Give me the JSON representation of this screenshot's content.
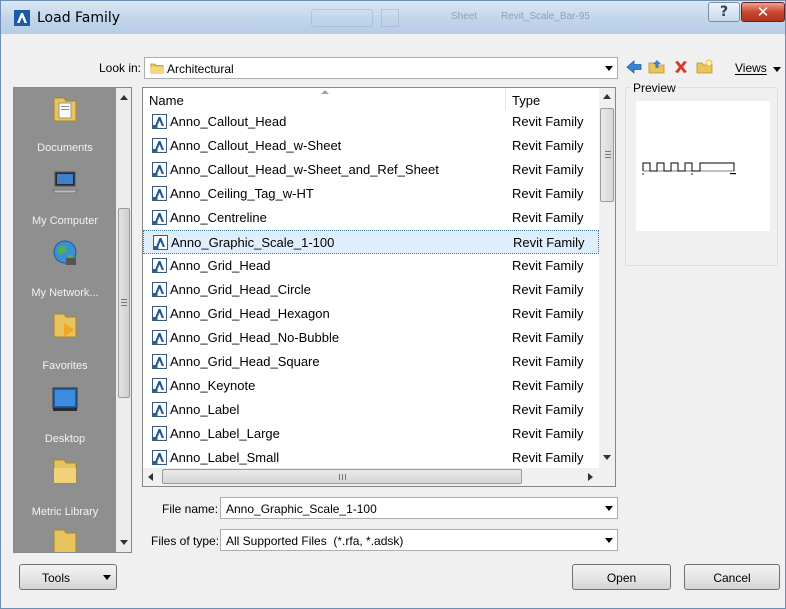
{
  "window": {
    "title": "Load Family",
    "background_titles": [
      "Sheet",
      "Revit_Scale_Bar-95"
    ]
  },
  "lookin": {
    "label": "Look in:",
    "value": "Architectural"
  },
  "toolbar": {
    "icons": [
      "back-icon",
      "up-folder-icon",
      "delete-icon",
      "new-folder-icon"
    ],
    "views_label": "Views"
  },
  "places": [
    {
      "label": "Documents",
      "icon": "documents-icon"
    },
    {
      "label": "My Computer",
      "icon": "computer-icon"
    },
    {
      "label": "My Network...",
      "icon": "network-icon"
    },
    {
      "label": "Favorites",
      "icon": "favorites-icon"
    },
    {
      "label": "Desktop",
      "icon": "desktop-icon"
    },
    {
      "label": "Metric Library",
      "icon": "folder-icon"
    }
  ],
  "filelist": {
    "columns": {
      "name": "Name",
      "type": "Type"
    },
    "rows": [
      {
        "name": "Anno_Callout_Head",
        "type": "Revit Family"
      },
      {
        "name": "Anno_Callout_Head_w-Sheet",
        "type": "Revit Family"
      },
      {
        "name": "Anno_Callout_Head_w-Sheet_and_Ref_Sheet",
        "type": "Revit Family"
      },
      {
        "name": "Anno_Ceiling_Tag_w-HT",
        "type": "Revit Family"
      },
      {
        "name": "Anno_Centreline",
        "type": "Revit Family"
      },
      {
        "name": "Anno_Graphic_Scale_1-100",
        "type": "Revit Family",
        "selected": true
      },
      {
        "name": "Anno_Grid_Head",
        "type": "Revit Family"
      },
      {
        "name": "Anno_Grid_Head_Circle",
        "type": "Revit Family"
      },
      {
        "name": "Anno_Grid_Head_Hexagon",
        "type": "Revit Family"
      },
      {
        "name": "Anno_Grid_Head_No-Bubble",
        "type": "Revit Family"
      },
      {
        "name": "Anno_Grid_Head_Square",
        "type": "Revit Family"
      },
      {
        "name": "Anno_Keynote",
        "type": "Revit Family"
      },
      {
        "name": "Anno_Label",
        "type": "Revit Family"
      },
      {
        "name": "Anno_Label_Large",
        "type": "Revit Family"
      },
      {
        "name": "Anno_Label_Small",
        "type": "Revit Family"
      }
    ]
  },
  "preview": {
    "label": "Preview"
  },
  "filename": {
    "label": "File name:",
    "value": "Anno_Graphic_Scale_1-100"
  },
  "filetype": {
    "label": "Files of type:",
    "value": "All Supported Files  (*.rfa, *.adsk)"
  },
  "buttons": {
    "tools": "Tools",
    "open": "Open",
    "cancel": "Cancel"
  },
  "colors": {
    "selection": "#dfeefc",
    "title_bar": "#c1d5ea",
    "close_button": "#c9472f"
  }
}
